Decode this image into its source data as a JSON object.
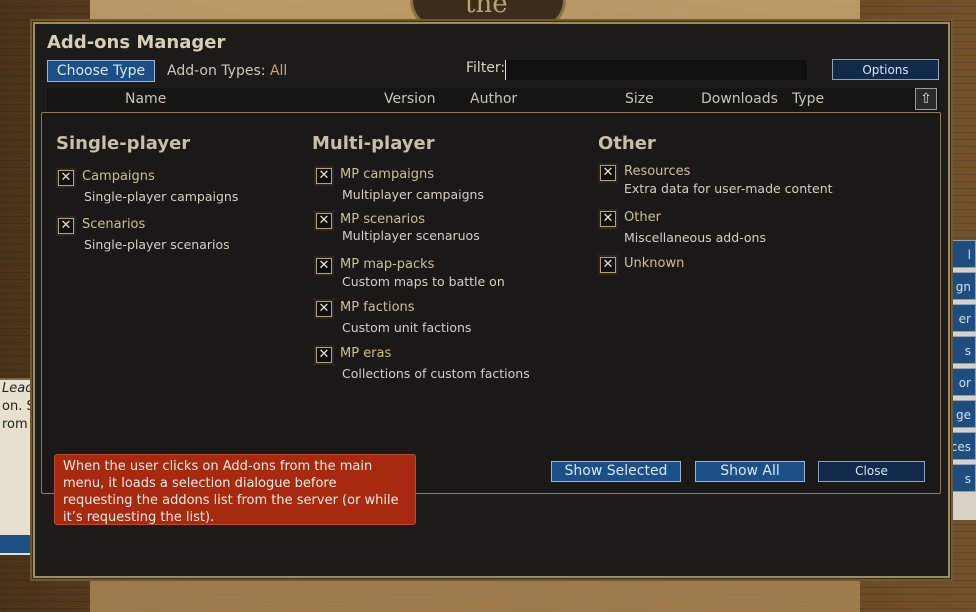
{
  "background": {
    "logo_text": "the",
    "left_panel_lines": [
      "Leade",
      "on. S",
      "rom t"
    ],
    "right_buttons": [
      "l",
      "gn",
      "er",
      "s",
      "or",
      "ge",
      "ces",
      "s"
    ]
  },
  "dialog": {
    "title": "Add-ons Manager",
    "choose_type_label": "Choose Type",
    "addon_types_label": "Add-on Types:",
    "addon_types_value": "All",
    "filter_label": "Filter:",
    "filter_value": "",
    "options_label": "Options",
    "columns": [
      "Name",
      "Version",
      "Author",
      "Size",
      "Downloads",
      "Type"
    ],
    "scroll_up_glyph": "⇧"
  },
  "sections": {
    "single": {
      "title": "Single-player",
      "items": [
        {
          "label": "Campaigns",
          "desc": "Single-player campaigns",
          "checked": true
        },
        {
          "label": "Scenarios",
          "desc": "Single-player scenarios",
          "checked": true
        }
      ]
    },
    "multi": {
      "title": "Multi-player",
      "items": [
        {
          "label": "MP campaigns",
          "desc": "Multiplayer campaigns",
          "checked": true
        },
        {
          "label": "MP scenarios",
          "desc": "Multiplayer scenaruos",
          "checked": true
        },
        {
          "label": "MP map-packs",
          "desc": "Custom maps to battle on",
          "checked": true
        },
        {
          "label": "MP factions",
          "desc": "Custom unit factions",
          "checked": true
        },
        {
          "label": "MP eras",
          "desc": "Collections of custom factions",
          "checked": true
        }
      ]
    },
    "other": {
      "title": "Other",
      "items": [
        {
          "label": "Resources",
          "desc": "Extra data for user-made content",
          "checked": true
        },
        {
          "label": "Other",
          "desc": "Miscellaneous add-ons",
          "checked": true
        },
        {
          "label": "Unknown",
          "desc": "",
          "checked": true
        }
      ]
    }
  },
  "buttons": {
    "show_selected": "Show Selected",
    "show_all": "Show All",
    "close": "Close"
  },
  "checkbox_glyph": "✕",
  "callout_text": "When the user clicks on Add-ons from the main menu, it loads a selection dialogue before requesting the addons list from the server (or while it’s requesting the list)."
}
